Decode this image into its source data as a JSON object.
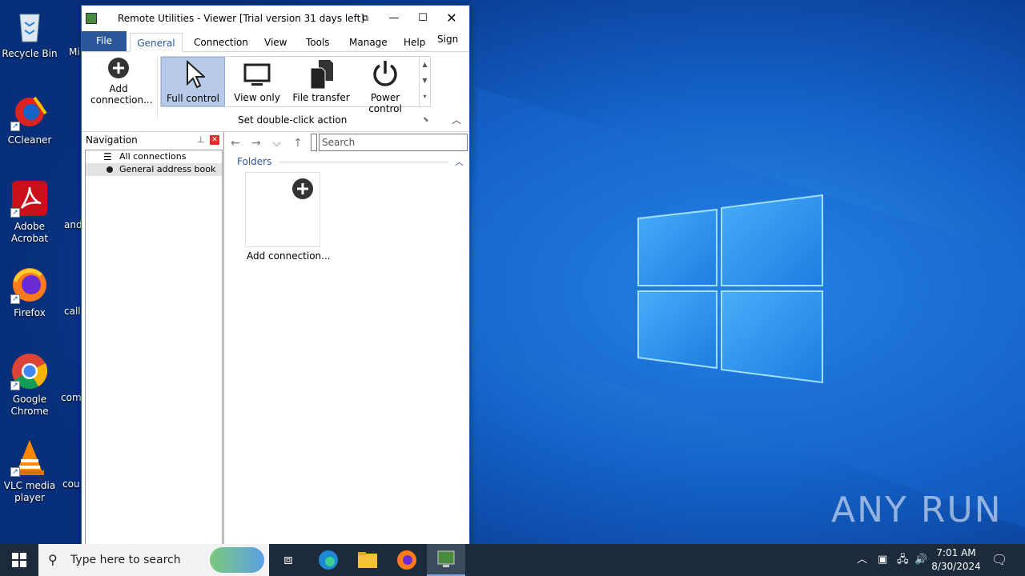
{
  "desktop": {
    "icons": [
      {
        "id": "recycle-bin",
        "label": "Recycle Bin"
      },
      {
        "id": "ccleaner",
        "label": "CCleaner"
      },
      {
        "id": "adobe-acrobat",
        "label": "Adobe Acrobat"
      },
      {
        "id": "firefox",
        "label": "Firefox"
      },
      {
        "id": "google-chrome",
        "label": "Google Chrome"
      },
      {
        "id": "vlc",
        "label": "VLC media player"
      }
    ],
    "partial_labels": [
      "Mi",
      "and",
      "call",
      "com",
      "cou"
    ],
    "watermark": "ANY RUN"
  },
  "window": {
    "title": "Remote Utilities - Viewer [Trial version 31 days left]",
    "tabs": [
      "File",
      "General",
      "Connection",
      "View",
      "Tools",
      "Manage",
      "Help"
    ],
    "active_tab": "General",
    "sign_in": "Sign in",
    "ribbon": {
      "add_connection": "Add connection...",
      "modes": [
        {
          "label": "Full control",
          "selected": true
        },
        {
          "label": "View only",
          "selected": false
        },
        {
          "label": "File transfer",
          "selected": false
        },
        {
          "label": "Power control",
          "selected": false
        }
      ],
      "group_label": "Set double-click action"
    },
    "navigation": {
      "title": "Navigation",
      "items": [
        "All connections",
        "General address book"
      ]
    },
    "main": {
      "search_placeholder": "Search",
      "folders_label": "Folders",
      "tile_label": "Add connection..."
    }
  },
  "taskbar": {
    "search_placeholder": "Type here to search",
    "time": "7:01 AM",
    "date": "8/30/2024"
  },
  "colors": {
    "accent": "#2b579a",
    "selection": "#b7cbe9",
    "taskbar": "#1c2a3c"
  }
}
